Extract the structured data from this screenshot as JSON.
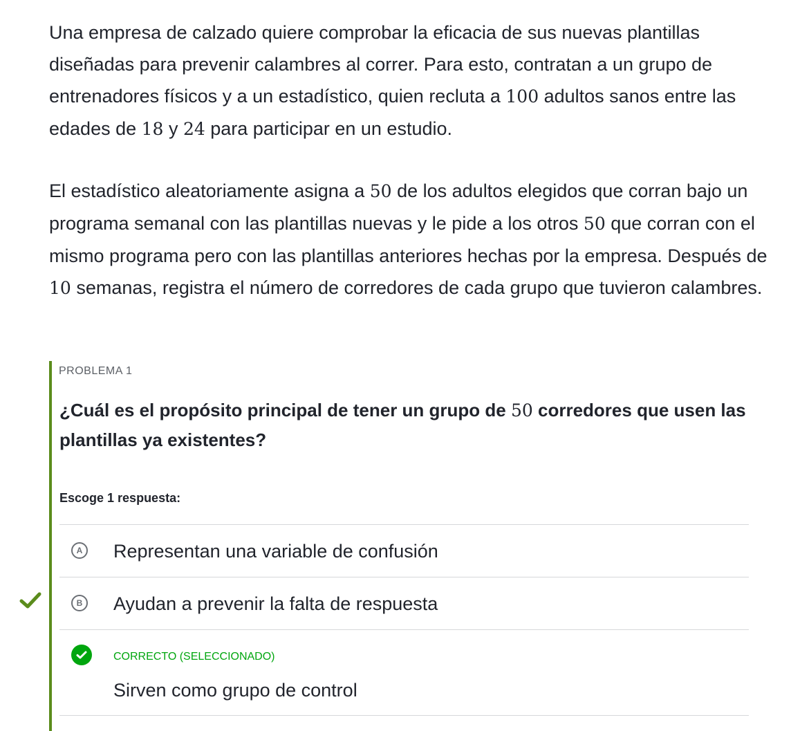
{
  "passage": {
    "p1": {
      "t1": "Una empresa de calzado quiere comprobar la eficacia de sus nuevas plantillas diseñadas para prevenir calambres al correr. Para esto, contratan a un grupo de entrenadores físicos y a un estadístico, quien recluta a ",
      "n1": "100",
      "t2": " adultos sanos entre las edades de ",
      "n2": "18",
      "t3": " y ",
      "n3": "24",
      "t4": " para participar en un estudio."
    },
    "p2": {
      "t1": "El estadístico aleatoriamente asigna a ",
      "n1": "50",
      "t2": " de los adultos elegidos que corran bajo un programa semanal con las plantillas nuevas y le pide a los otros ",
      "n2": "50",
      "t3": " que corran con el mismo programa pero con las plantillas anteriores hechas por la empresa. Después de ",
      "n3": "10",
      "t4": " semanas, registra el número de corredores de cada grupo que tuvieron calambres."
    }
  },
  "problem": {
    "label": "PROBLEMA 1",
    "question": {
      "t1": "¿Cuál es el propósito principal de tener un grupo de ",
      "n1": "50",
      "t2": " corredores que usen las plantillas ya existentes?"
    },
    "instruction": "Escoge 1 respuesta:",
    "choices": [
      {
        "letter": "A",
        "text": "Representan una variable de confusión"
      },
      {
        "letter": "B",
        "text": "Ayudan a prevenir la falta de respuesta"
      },
      {
        "status": "CORRECTO (SELECCIONADO)",
        "text": "Sirven como grupo de control"
      }
    ]
  },
  "colors": {
    "accent_bar": "#5b8c1c",
    "correct": "#00a60e",
    "side_check": "#5b8c1c"
  }
}
